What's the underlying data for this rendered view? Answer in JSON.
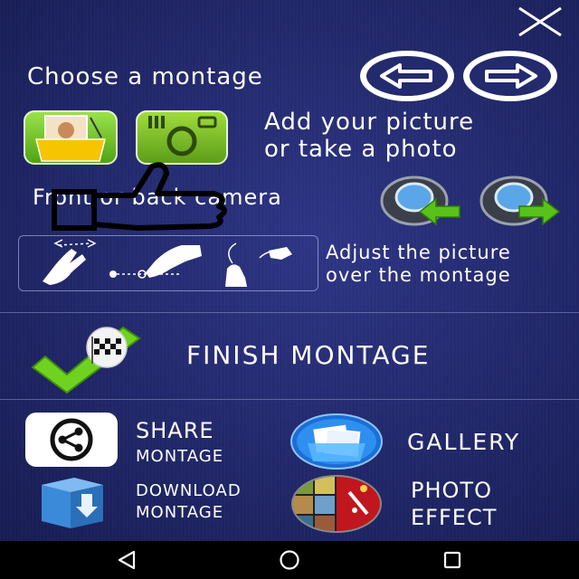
{
  "header": {
    "close_icon": "close-icon",
    "choose_montage": "Choose a montage",
    "prev_icon": "arrow-left-icon",
    "next_icon": "arrow-right-icon"
  },
  "add_picture": {
    "line1": "Add your picture",
    "line2": "or take a photo"
  },
  "camera": {
    "label": "Front or back camera"
  },
  "adjust": {
    "line1": "Adjust the picture",
    "line2": "over the montage"
  },
  "finish": {
    "label": "FINISH MONTAGE"
  },
  "actions": {
    "share_line1": "SHARE",
    "share_line2": "MONTAGE",
    "gallery": "GALLERY",
    "download_line1": "DOWNLOAD",
    "download_line2": "MONTAGE",
    "effect_line1": "PHOTO",
    "effect_line2": "EFFECT"
  },
  "colors": {
    "background": "#232a6e",
    "text": "#ffffff",
    "accent_green": "#7ed321"
  }
}
